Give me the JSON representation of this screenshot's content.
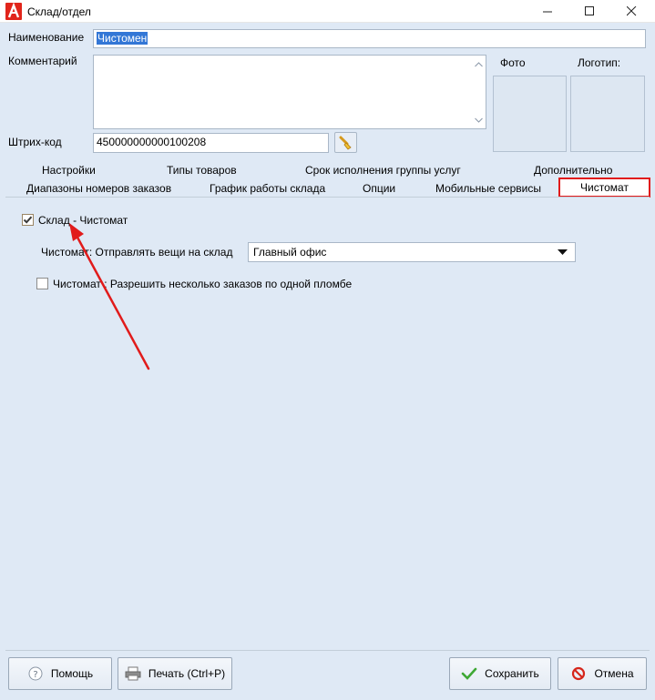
{
  "window": {
    "title": "Склад/отдел"
  },
  "form": {
    "name_label": "Наименование",
    "name_value": "Чистомен",
    "comment_label": "Комментарий",
    "comment_value": "",
    "photo_label": "Фото",
    "logo_label": "Логотип:",
    "barcode_label": "Штрих-код",
    "barcode_value": "450000000000100208"
  },
  "tabs": {
    "row1": [
      "Настройки",
      "Типы товаров",
      "Срок исполнения группы услуг",
      "Дополнительно"
    ],
    "row2": [
      "Диапазоны номеров заказов",
      "График работы склада",
      "Опции",
      "Мобильные сервисы",
      "Чистомат"
    ],
    "active": "Чистомат"
  },
  "chistomat": {
    "enable_label": "Склад - Чистомат",
    "enable_checked": true,
    "send_label": "Чистомат: Отправлять вещи на склад",
    "send_value": "Главный офис",
    "multi_label": "Чистомат : Разрешить несколько заказов по одной пломбе",
    "multi_checked": false
  },
  "buttons": {
    "help": "Помощь",
    "print": "Печать (Ctrl+P)",
    "save": "Сохранить",
    "cancel": "Отмена"
  },
  "colors": {
    "accent_red": "#e11b1b",
    "selection": "#3377d6",
    "background": "#dfe9f5"
  }
}
